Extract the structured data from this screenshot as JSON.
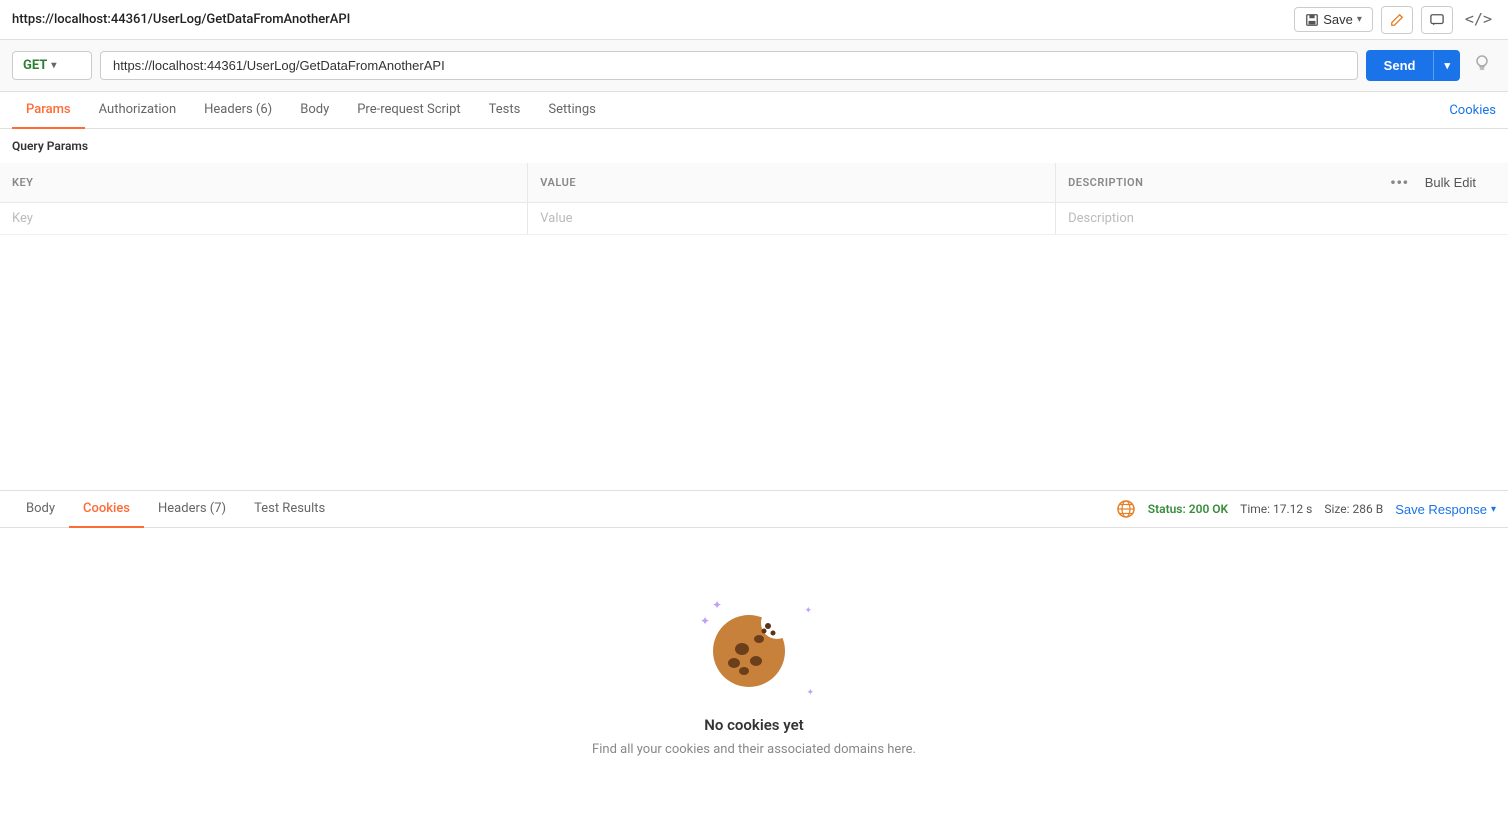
{
  "topBar": {
    "url": "https://localhost:44361/UserLog/GetDataFromAnotherAPI",
    "saveLabel": "Save",
    "saveChevron": "▾"
  },
  "urlBar": {
    "method": "GET",
    "methodChevron": "▾",
    "url": "https://localhost:44361/UserLog/GetDataFromAnotherAPI",
    "sendLabel": "Send",
    "sendChevron": "▾"
  },
  "requestTabs": {
    "tabs": [
      {
        "id": "params",
        "label": "Params",
        "active": true
      },
      {
        "id": "authorization",
        "label": "Authorization",
        "active": false
      },
      {
        "id": "headers",
        "label": "Headers (6)",
        "active": false
      },
      {
        "id": "body",
        "label": "Body",
        "active": false
      },
      {
        "id": "prerequest",
        "label": "Pre-request Script",
        "active": false
      },
      {
        "id": "tests",
        "label": "Tests",
        "active": false
      },
      {
        "id": "settings",
        "label": "Settings",
        "active": false
      }
    ],
    "cookiesLink": "Cookies"
  },
  "queryParams": {
    "sectionLabel": "Query Params",
    "columns": {
      "key": "KEY",
      "value": "VALUE",
      "description": "DESCRIPTION"
    },
    "bulkEdit": "Bulk Edit",
    "placeholder": {
      "key": "Key",
      "value": "Value",
      "description": "Description"
    }
  },
  "responseTabs": {
    "tabs": [
      {
        "id": "body",
        "label": "Body",
        "active": false
      },
      {
        "id": "cookies",
        "label": "Cookies",
        "active": true
      },
      {
        "id": "headers",
        "label": "Headers (7)",
        "active": false
      },
      {
        "id": "testresults",
        "label": "Test Results",
        "active": false
      }
    ],
    "status": "Status: 200 OK",
    "time": "Time: 17.12 s",
    "size": "Size: 286 B",
    "saveResponse": "Save Response",
    "saveChevron": "▾"
  },
  "cookieEmpty": {
    "title": "No cookies yet",
    "description": "Find all your cookies and their associated domains here."
  }
}
